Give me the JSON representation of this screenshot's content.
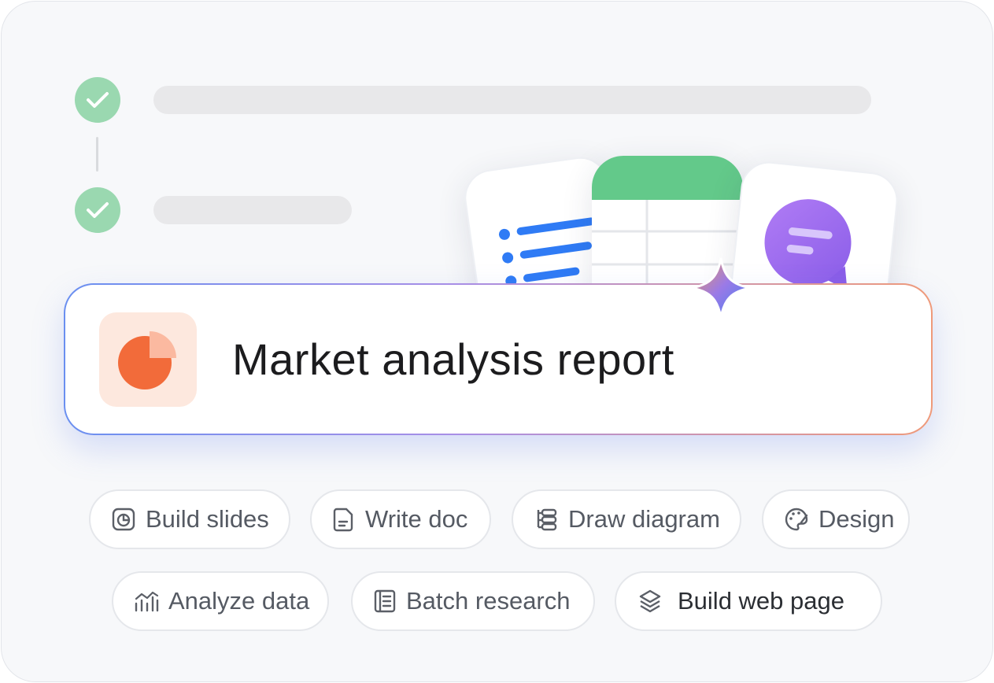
{
  "prompt": {
    "text": "Market analysis report"
  },
  "chips_row1": [
    {
      "label": "Build slides",
      "icon": "slides-icon"
    },
    {
      "label": "Write doc",
      "icon": "doc-icon"
    },
    {
      "label": "Draw diagram",
      "icon": "diagram-icon"
    },
    {
      "label": "Design",
      "icon": "palette-icon"
    }
  ],
  "chips_row2": [
    {
      "label": "Analyze data",
      "icon": "chart-icon"
    },
    {
      "label": "Batch research",
      "icon": "book-icon"
    },
    {
      "label": "Build web page",
      "icon": "layers-icon"
    }
  ],
  "colors": {
    "check_green": "#9ad8b0",
    "sheet_green": "#63c98a",
    "list_blue": "#2f7bf5",
    "chat_purple": "#9b6bf0",
    "pie_orange": "#f26b3a"
  }
}
